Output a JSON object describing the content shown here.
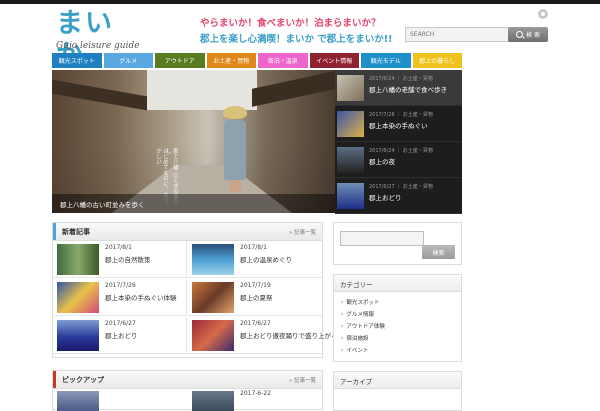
{
  "header": {
    "logo_main": "まいか",
    "logo_sub": "Gujo leisure guide",
    "tagline1": "やらまいか！食べまいか！泊まらまいか？",
    "tagline2": "郡上を楽し心満喫！まいか で郡上をまいか!!",
    "search_placeholder": "SEARCH",
    "search_button": "検 索"
  },
  "nav": [
    {
      "label": "観光スポット",
      "color": "#1e7fc1"
    },
    {
      "label": "グルメ",
      "color": "#5aa8e0"
    },
    {
      "label": "アウトドア",
      "color": "#5a7a22"
    },
    {
      "label": "お土産・買物",
      "color": "#e0871a"
    },
    {
      "label": "宿泊・温泉",
      "color": "#ee66cc"
    },
    {
      "label": "イベント情報",
      "color": "#8e2231"
    },
    {
      "label": "観光モデル",
      "color": "#1f8fc9"
    },
    {
      "label": "郡上の暮らし",
      "color": "#f0c21c"
    }
  ],
  "hero": {
    "vertical_text_1": "はじめてなのに、なつかしい",
    "vertical_text_2": "郡上八幡 山と水の暮らし",
    "caption": "郡上八幡の古い町並みを歩く"
  },
  "side_posts": [
    {
      "date": "2017/6/24",
      "category": "お土産・買物",
      "title": "郡上八幡の老舗で食べ歩き"
    },
    {
      "date": "2017/7/26",
      "category": "お土産・買物",
      "title": "郡上本染の手ぬぐい"
    },
    {
      "date": "2017/6/24",
      "category": "お土産・買物",
      "title": "郡上の夜"
    },
    {
      "date": "2017/6/27",
      "category": "お土産・買物",
      "title": "郡上おどり"
    }
  ],
  "new_posts": {
    "title": "新着記事",
    "more": "記事一覧",
    "items": [
      {
        "date": "2017/8/1",
        "title": "郡上の自然散策"
      },
      {
        "date": "2017/8/1",
        "title": "郡上の温泉めぐり"
      },
      {
        "date": "2017/7/26",
        "title": "郡上本染の手ぬぐい体験"
      },
      {
        "date": "2017/7/19",
        "title": "郡上の夏祭"
      },
      {
        "date": "2017/6/27",
        "title": "郡上おどり"
      },
      {
        "date": "2017/6/27",
        "title": "郡上おどり徹夜踊りで盛り上がろう郡上八幡"
      }
    ]
  },
  "pickup": {
    "title": "ピックアップ",
    "more": "記事一覧",
    "date": "2017-6-22"
  },
  "sidebar": {
    "search_button": "検索",
    "category_title": "カテゴリー",
    "categories": [
      "観光スポット",
      "グルメ情報",
      "アウトドア体験",
      "宿泊施設",
      "イベント"
    ],
    "archive_title": "アーカイブ"
  }
}
